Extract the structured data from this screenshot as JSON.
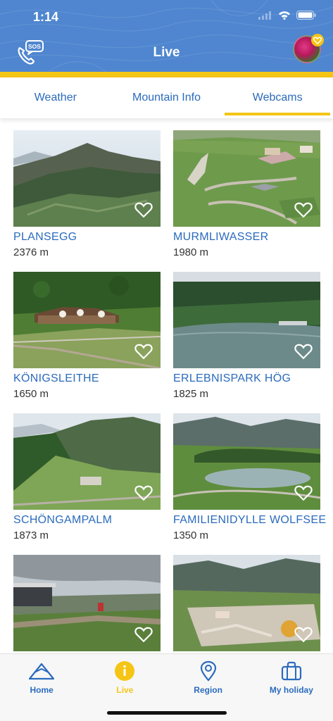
{
  "status": {
    "time": "1:14"
  },
  "header": {
    "title": "Live"
  },
  "tabs": [
    {
      "label": "Weather",
      "active": false
    },
    {
      "label": "Mountain Info",
      "active": false
    },
    {
      "label": "Webcams",
      "active": true
    }
  ],
  "webcams": [
    {
      "name": "PLANSEGG",
      "altitude": "2376 m"
    },
    {
      "name": "MURMLIWASSER",
      "altitude": "1980 m"
    },
    {
      "name": "KÖNIGSLEITHE",
      "altitude": "1650 m"
    },
    {
      "name": "ERLEBNISPARK HÖG",
      "altitude": "1825 m"
    },
    {
      "name": "SCHÖNGAMPALM",
      "altitude": "1873 m"
    },
    {
      "name": "FAMILIENIDYLLE WOLFSEE",
      "altitude": "1350 m"
    },
    {
      "name": "",
      "altitude": ""
    },
    {
      "name": "",
      "altitude": ""
    }
  ],
  "bottom_nav": [
    {
      "label": "Home",
      "icon": "mountain-icon",
      "active": false
    },
    {
      "label": "Live",
      "icon": "info-icon",
      "active": true
    },
    {
      "label": "Region",
      "icon": "location-pin-icon",
      "active": false
    },
    {
      "label": "My holiday",
      "icon": "suitcase-icon",
      "active": false
    }
  ],
  "colors": {
    "primary_blue": "#4f86cf",
    "accent_yellow": "#f5c516",
    "link_blue": "#2b6bbd"
  }
}
